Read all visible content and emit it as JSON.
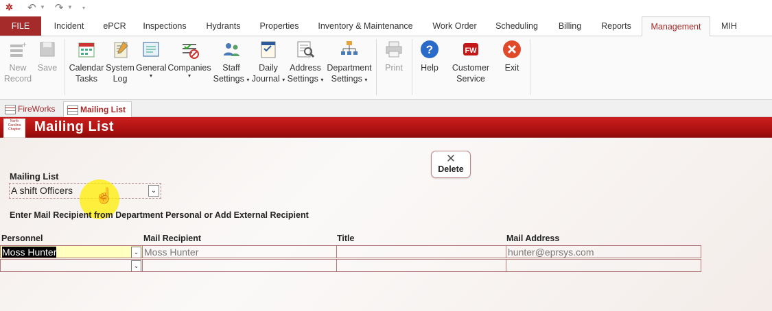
{
  "tabs": [
    "FILE",
    "Incident",
    "ePCR",
    "Inspections",
    "Hydrants",
    "Properties",
    "Inventory & Maintenance",
    "Work Order",
    "Scheduling",
    "Billing",
    "Reports",
    "Management",
    "MIH"
  ],
  "ribbon": {
    "new_record": [
      "New",
      "Record"
    ],
    "save": "Save",
    "calendar_tasks": [
      "Calendar",
      "Tasks"
    ],
    "system_log": [
      "System",
      "Log"
    ],
    "general": "General",
    "companies": "Companies",
    "staff_settings": [
      "Staff",
      "Settings"
    ],
    "daily_journal": [
      "Daily",
      "Journal"
    ],
    "address_settings": [
      "Address",
      "Settings"
    ],
    "department_settings": [
      "Department",
      "Settings"
    ],
    "print": "Print",
    "help": "Help",
    "customer_service": [
      "Customer",
      "Service"
    ],
    "exit": "Exit"
  },
  "doc_tabs": [
    "FireWorks",
    "Mailing List"
  ],
  "header": {
    "title": "Mailing List",
    "logo_text": "North Carolina Chapter"
  },
  "form": {
    "delete_label": "Delete",
    "mailing_list_label": "Mailing List",
    "mailing_list_value": "A shift Officers",
    "instruction": "Enter Mail Recipient from Department Personal or Add External Recipient",
    "columns": [
      "Personnel",
      "Mail Recipient",
      "Title",
      "Mail Address"
    ],
    "rows": [
      {
        "personnel": "Moss Hunter",
        "recipient": "Moss Hunter",
        "title": "",
        "address": "hunter@eprsys.com"
      },
      {
        "personnel": "",
        "recipient": "",
        "title": "",
        "address": ""
      }
    ]
  },
  "colors": {
    "accent": "#a52a2a",
    "header_red": "#c41818",
    "highlight": "#ffee00"
  }
}
